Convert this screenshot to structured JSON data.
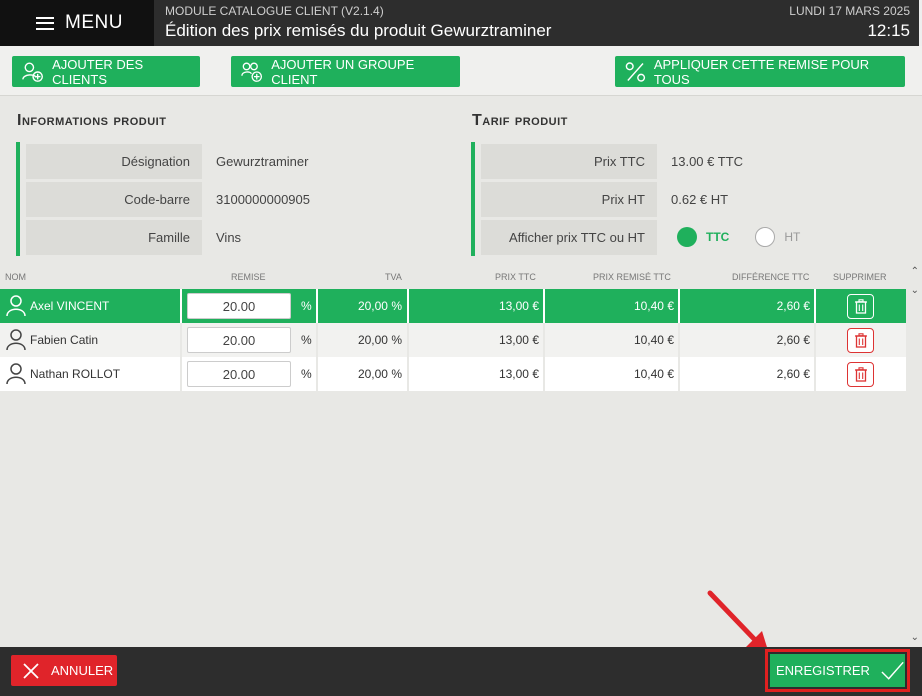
{
  "header": {
    "menu_label": "MENU",
    "module_title": "MODULE CATALOGUE CLIENT (V2.1.4)",
    "page_title": "Édition des prix remisés du produit Gewurztraminer",
    "date": "LUNDI 17 MARS 2025",
    "time": "12:15"
  },
  "toolbar": {
    "add_clients": "AJOUTER DES CLIENTS",
    "add_group": "AJOUTER UN GROUPE CLIENT",
    "apply_all": "APPLIQUER CETTE REMISE POUR TOUS"
  },
  "product_info": {
    "title": "Informations produit",
    "rows": [
      {
        "label": "Désignation",
        "value": "Gewurztraminer"
      },
      {
        "label": "Code-barre",
        "value": "3100000000905"
      },
      {
        "label": "Famille",
        "value": "Vins"
      }
    ]
  },
  "tarif": {
    "title": "Tarif produit",
    "rows": [
      {
        "label": "Prix TTC",
        "value": "13.00 € TTC"
      },
      {
        "label": "Prix HT",
        "value": "0.62 € HT"
      },
      {
        "label": "Afficher prix TTC ou HT",
        "value": ""
      }
    ],
    "radio_ttc": "TTC",
    "radio_ht": "HT"
  },
  "table": {
    "columns": [
      "NOM",
      "REMISE",
      "TVA",
      "PRIX TTC",
      "PRIX REMISÉ TTC",
      "DIFFÉRENCE TTC",
      "SUPPRIMER"
    ],
    "percent_sign": "%",
    "rows": [
      {
        "name": "Axel VINCENT",
        "remise": "20.00",
        "tva": "20,00 %",
        "prix_ttc": "13,00 €",
        "prix_remise": "10,40 €",
        "difference": "2,60 €"
      },
      {
        "name": "Fabien Catin",
        "remise": "20.00",
        "tva": "20,00 %",
        "prix_ttc": "13,00 €",
        "prix_remise": "10,40 €",
        "difference": "2,60 €"
      },
      {
        "name": "Nathan ROLLOT",
        "remise": "20.00",
        "tva": "20,00 %",
        "prix_ttc": "13,00 €",
        "prix_remise": "10,40 €",
        "difference": "2,60 €"
      }
    ]
  },
  "footer": {
    "cancel": "ANNULER",
    "save": "ENREGISTRER"
  },
  "colors": {
    "accent": "#1fb05c",
    "danger": "#e0242a",
    "header_bg": "#2d2d2d"
  }
}
